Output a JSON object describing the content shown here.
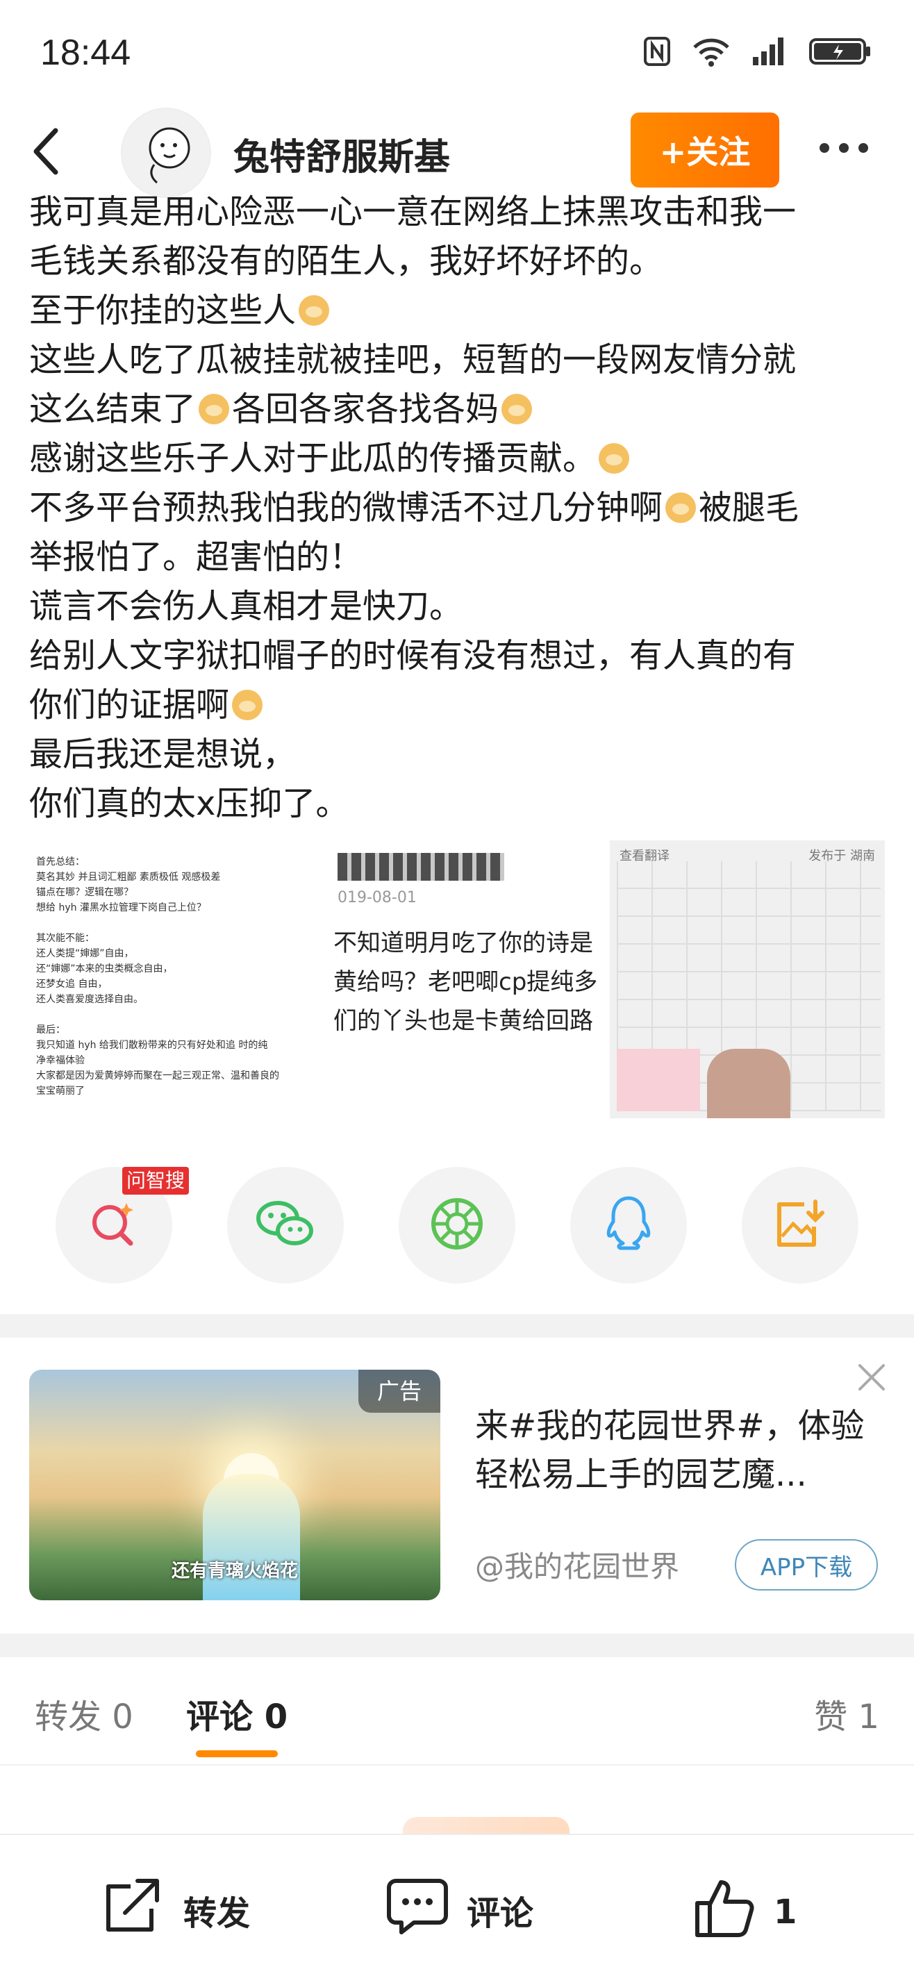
{
  "status_bar": {
    "time": "18:44"
  },
  "header": {
    "user_name": "兔特舒服斯基",
    "follow_label": "+关注"
  },
  "post": {
    "lines": [
      "我可真是用心险恶一心一意在网络上抹黑攻击和我一",
      "毛钱关系都没有的陌生人，我好坏好坏的。",
      "至于你挂的这些人",
      "这些人吃了瓜被挂就被挂吧，短暂的一段网友情分就",
      "这么结束了",
      "各回各家各找各妈",
      "感谢这些乐子人对于此瓜的传播贡献。",
      "不多平台预热我怕我的微博活不过几分钟啊",
      "被腿毛",
      "举报怕了。超害怕的！",
      "谎言不会伤人真相才是快刀。",
      "给别人文字狱扣帽子的时候有没有想过，有人真的有",
      "你们的证据啊",
      "最后我还是想说，",
      "你们真的太x压抑了。"
    ]
  },
  "images": {
    "thumb1_lines": [
      "首先总结：",
      "莫名其妙 并且词汇粗鄙 素质极低 观感极差",
      "锚点在哪？逻辑在哪？",
      "想给 hyh 灌黑水拉管理下岗自己上位？",
      "",
      "其次能不能：",
      "还人类提“婶娜”自由，",
      "还“婶娜”本来的虫类概念自由，",
      "还梦女追 自由，",
      "还人类喜爱度选择自由。",
      "",
      "最后：",
      "我只知道 hyh 给我们散粉带来的只有好处和追 时的纯",
      "净幸福体验",
      "大家都是因为爱黄婷婷而聚在一起三观正常、温和善良的",
      "宝宝萌丽了"
    ],
    "thumb2_date": "019-08-01",
    "thumb2_lines": [
      "不知道明月吃了你的诗是",
      "黄给吗？老吧唧cp提纯多",
      "们的丫头也是卡黄给回路"
    ],
    "thumb3_header": "查看翻译",
    "thumb3_location": "发布于 湖南"
  },
  "share": {
    "badge": "问智搜",
    "icons": [
      "search-ai-icon",
      "wechat-icon",
      "moments-icon",
      "qq-icon",
      "save-image-icon"
    ]
  },
  "ad": {
    "tag": "广告",
    "caption": "还有青璃火焰花",
    "title": "来#我的花园世界#，体验轻松易上手的园艺魔...",
    "source": "@我的花园世界",
    "download_label": "APP下载"
  },
  "tabs": {
    "repost": "转发 0",
    "comment": "评论 0",
    "like": "赞 1"
  },
  "bottom_bar": {
    "repost": "转发",
    "comment": "评论",
    "like_count": "1"
  },
  "colors": {
    "accent": "#ff8a00",
    "badge": "#e63030",
    "link": "#3d87b8"
  }
}
